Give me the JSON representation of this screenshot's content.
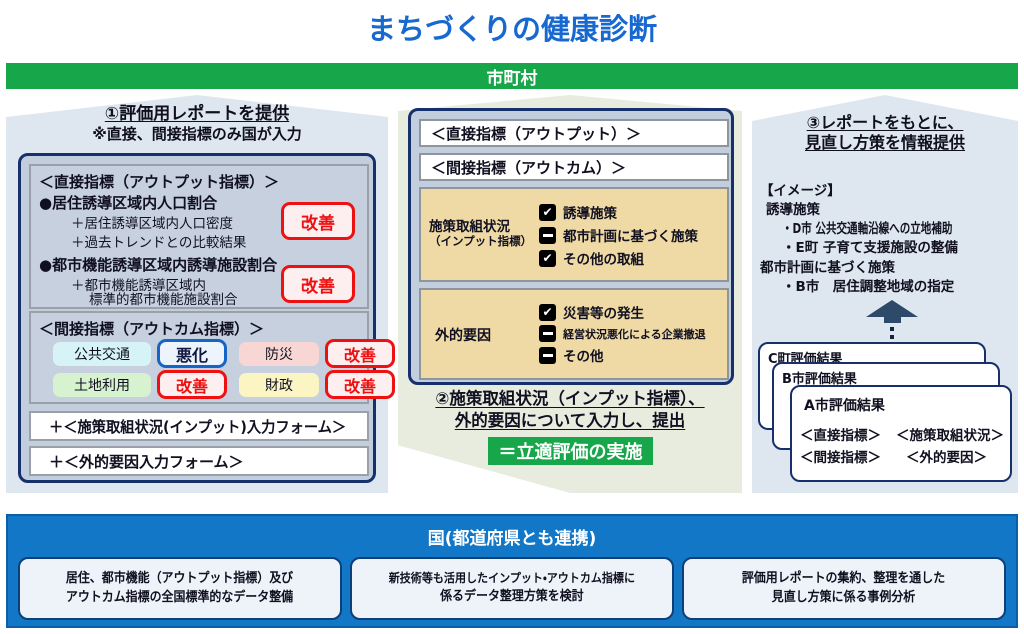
{
  "title": "まちづくりの健康診断",
  "municipality_band": "市町村",
  "left_panel": {
    "heading_main": "①評価用レポートを提供",
    "heading_sub": "※直接、間接指標のみ国が入力",
    "direct": {
      "section_title": "＜直接指標（アウトプット指標）＞",
      "items": [
        {
          "bullet": "●居住誘導区域内人口割合",
          "subs": [
            "＋居住誘導区域内人口密度",
            "＋過去トレンドとの比較結果"
          ],
          "badge": "改善"
        },
        {
          "bullet": "●都市機能誘導区域内誘導施設割合",
          "subs": [
            "＋都市機能誘導区域内",
            "標準的都市機能施設割合"
          ],
          "badge": "改善"
        }
      ]
    },
    "indirect": {
      "section_title": "＜間接指標（アウトカム指標）＞",
      "rows": [
        {
          "name": "公共交通",
          "name_color": "#d6f4f7",
          "status": "悪化",
          "status_type": "worse"
        },
        {
          "name": "防災",
          "name_color": "#f8d6d3",
          "status": "改善",
          "status_type": "better"
        },
        {
          "name": "土地利用",
          "name_color": "#d6f2cf",
          "status": "改善",
          "status_type": "better"
        },
        {
          "name": "財政",
          "name_color": "#fbf5c4",
          "status": "改善",
          "status_type": "better"
        }
      ]
    },
    "forms": [
      "＋＜施策取組状況(インプット)入力フォーム＞",
      "＋＜外的要因入力フォーム＞"
    ]
  },
  "center_panel": {
    "row_direct": "＜直接指標（アウトプット）＞",
    "row_indirect": "＜間接指標（アウトカム）＞",
    "input_block": {
      "label_line1": "施策取組状況",
      "label_line2": "（インプット指標）",
      "checks": [
        {
          "state": "checked",
          "label": "誘導施策"
        },
        {
          "state": "dash",
          "label": "都市計画に基づく施策"
        },
        {
          "state": "checked",
          "label": "その他の取組"
        }
      ]
    },
    "external_block": {
      "label_line1": "外的要因",
      "checks": [
        {
          "state": "checked",
          "label": "災害等の発生"
        },
        {
          "state": "dash",
          "label": "経営状況悪化による企業撤退"
        },
        {
          "state": "dash",
          "label": "その他"
        }
      ]
    },
    "step2_line1": "②施策取組状況（インプット指標）、",
    "step2_line2": "外的要因について入力し、提出",
    "green_pill": "＝立適評価の実施"
  },
  "right_panel": {
    "heading_line1": "③レポートをもとに、",
    "heading_line2": "見直し方策を情報提供",
    "image_label": "【イメージ】",
    "group1_title": "誘導施策",
    "group1_items": [
      "・D市 公共交通軸沿線への立地補助",
      "・E町 子育て支援施設の整備"
    ],
    "group2_title": "都市計画に基づく施策",
    "group2_items": [
      "・B市　居住調整地域の指定"
    ],
    "cards": [
      {
        "title": "C町評価結果"
      },
      {
        "title": "B市評価結果"
      },
      {
        "title": "A市評価結果",
        "line1_a": "＜直接指標＞",
        "line1_b": "＜施策取組状況＞",
        "line2_a": "＜間接指標＞",
        "line2_b": "＜外的要因＞"
      }
    ]
  },
  "nation": {
    "title": "国(都道府県とも連携)",
    "cards": [
      {
        "line1": "居住、都市機能（アウトプット指標）及び",
        "line2": "アウトカム指標の全国標準的なデータ整備"
      },
      {
        "line1": "新技術等も活用したインプット・アウトカム指標に",
        "line2": "係るデータ整理方策を検討"
      },
      {
        "line1": "評価用レポートの集約、整理を通した",
        "line2": "見直し方策に係る事例分析"
      }
    ]
  },
  "colors": {
    "title_blue": "#1769d0",
    "green": "#17a64a",
    "navy": "#15306b",
    "nation_blue": "#1277c7",
    "red": "#ee1111",
    "tan": "#efd9a4"
  }
}
